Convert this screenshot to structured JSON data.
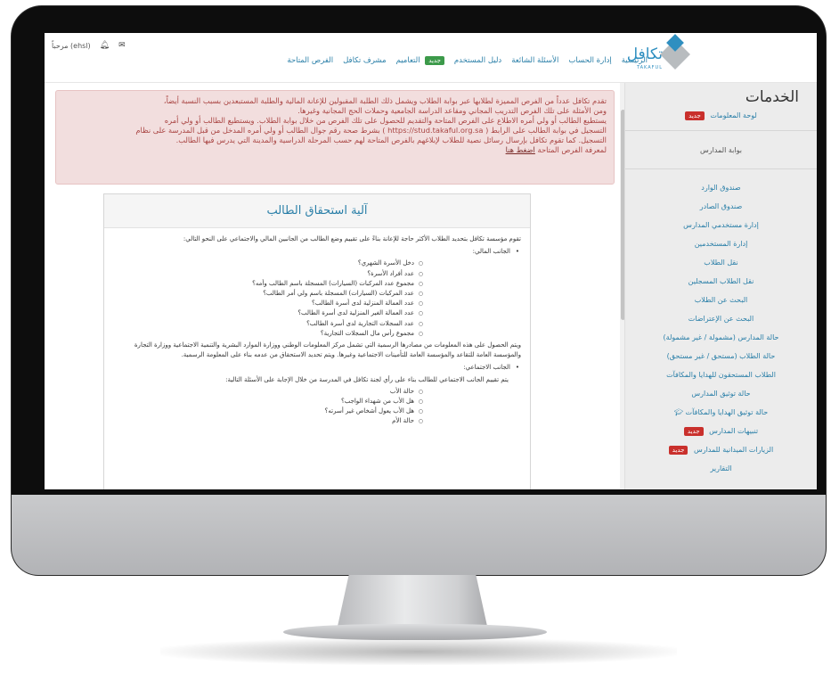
{
  "topbar": {
    "greeting": "مرحباً (ehsl)",
    "nav": [
      "الرئيسية",
      "إدارة الحساب",
      "الأسئلة الشائعة",
      "دليل المستخدم",
      "التعاميم",
      "مشرف تكافل",
      "الفرص المتاحة"
    ],
    "new_label": "جديد",
    "logo_text": "تكافل",
    "logo_sub": "TAKAFUL"
  },
  "alert": {
    "line1": "تقدم تكافل عدداً من الفرص المميزة لطلابها عبر بوابة الطلاب ويشمل ذلك الطلبة المقبولين للإعانة المالية والطلبة المستبعدين بسبب النسبة أيضاً،",
    "line2": "ومن الأمثلة على تلك الفرص التدريب المجاني ومقاعد الدراسة الجامعية وحملات الحج المجانية وغيرها.",
    "line3": "يستطيع الطالب أو ولي أمره الاطلاع على الفرص المتاحة والتقديم للحصول على تلك الفرص من خلال بوابة الطلاب. ويستطيع الطالب أو ولي أمره",
    "line4": "التسجيل في بوابة الطالب على الرابط ( https://stud.takaful.org.sa ) بشرط صحة رقم جوال الطالب أو ولي أمره المدخل من قبل المدرسة على نظام",
    "line5": "التسجيل. كما تقوم تكافل بإرسال رسائل نصية للطلاب لإبلاغهم بالفرص المتاحة لهم حسب المرحلة الدراسية والمدينة التي يدرس فيها الطالب.",
    "line6": "لمعرفة الفرص المتاحة",
    "link": "اضغط هنا"
  },
  "panel": {
    "title": "آلية استحقاق الطالب",
    "intro": "تقوم مؤسسة تكافل بتحديد الطلاب الأكثر حاجة للإعانة بناءً على تقييم وضع الطالب من الجانبين المالي والاجتماعي على النحو التالي:",
    "financial_heading": "الجانب المالي:",
    "financial_items": [
      "دخل الأسرة الشهري؟",
      "عدد أفراد الأسرة؟",
      "مجموع عدد المركبات (السيارات) المسجلة باسم الطالب وأمه؟",
      "عدد المركبات (السيارات) المسجلة باسم ولي أمر الطالب؟",
      "عدد العمالة المنزلية لدى أسرة الطالب؟",
      "عدد العمالة الغير المنزلية لدى أسرة الطالب؟",
      "عدد السجلات التجارية لدى أسرة الطالب؟",
      "مجموع رأس مال السجلات التجارية؟"
    ],
    "financial_note": "ويتم الحصول على هذه المعلومات من مصادرها الرسمية التي تشمل مركز المعلومات الوطني ووزارة الموارد البشرية والتنمية الاجتماعية ووزارة التجارة والمؤسسة العامة للتقاعد والمؤسسة العامة للتأمينات الاجتماعية وغيرها. ويتم تحديد الاستحقاق من عدمه بناء على المعلومة الرسمية.",
    "social_heading": "الجانب الاجتماعي:",
    "social_intro": "يتم تقييم الجانب الاجتماعي للطالب بناء على رأي لجنة تكافل في المدرسة من خلال الإجابة على الأسئلة التالية:",
    "social_items": [
      "حالة الأب",
      "هل الأب من شهداء الواجب؟",
      "هل الأب يعول أشخاص غير أسرته؟",
      "حالة الأم"
    ]
  },
  "sidebar": {
    "title": "الخدمات",
    "dashboard": "لوحة المعلومات",
    "group": "بوابة المدارس",
    "items": [
      "صندوق الوارد",
      "صندوق الصادر",
      "إدارة مستخدمي المدارس",
      "إدارة المستخدمين",
      "نقل الطلاب",
      "نقل الطلاب المسجلين",
      "البحث عن الطلاب",
      "البحث عن الإعتراضات",
      "حالة المدارس (مشمولة / غير مشمولة)",
      "حالة الطلاب (مستحق / غير مستحق)",
      "الطلاب المستحقون للهدايا والمكافآت",
      "حالة توثيق المدارس",
      "حالة توثيق الهدايا والمكافآت",
      "تنبيهات المدارس",
      "الزيارات الميدانية للمدارس",
      "التقارير"
    ],
    "new_label": "جديد"
  }
}
